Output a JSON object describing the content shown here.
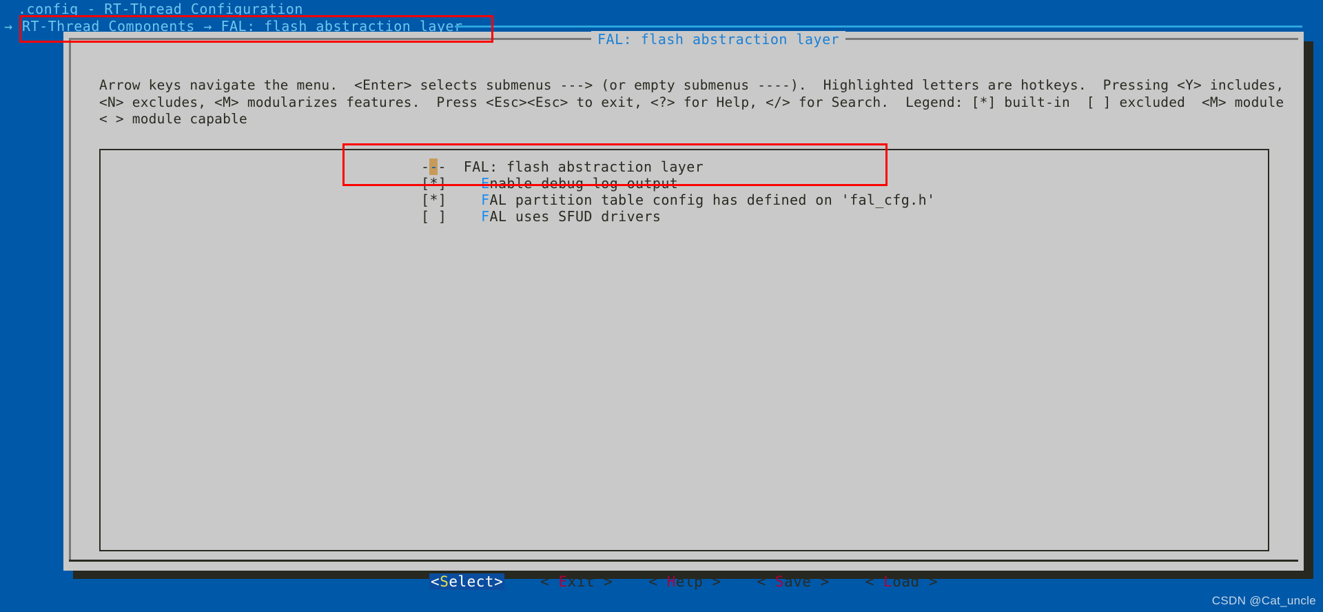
{
  "window": {
    "title": ".config - RT-Thread Configuration",
    "breadcrumb_arrow": "→",
    "breadcrumb": "RT-Thread Components → FAL: flash abstraction layer",
    "dialog_header": "FAL: flash abstraction layer"
  },
  "help": {
    "text": "Arrow keys navigate the menu.  <Enter> selects submenus ---> (or empty submenus ----).  Highlighted letters are hotkeys.  Pressing <Y> includes, <N> excludes, <M> modularizes features.  Press <Esc><Esc> to exit, <?> for Help, </> for Search.  Legend: [*] built-in  [ ] excluded  <M> module  < > module capable"
  },
  "menu": {
    "rows": [
      {
        "type": "header",
        "selected": true,
        "prefix": "-",
        "cursor": "-",
        "suffix": "-  ",
        "label": "FAL: flash abstraction layer"
      },
      {
        "type": "option",
        "selected": false,
        "state": "[*]",
        "hotkey": "E",
        "label": "nable debug log output"
      },
      {
        "type": "option",
        "selected": false,
        "state": "[*]",
        "hotkey": "F",
        "label": "AL partition table config has defined on 'fal_cfg.h'"
      },
      {
        "type": "option",
        "selected": false,
        "state": "[ ]",
        "hotkey": "F",
        "label": "AL uses SFUD drivers"
      }
    ]
  },
  "buttons": [
    {
      "name": "select",
      "open": "<",
      "hotkey": "S",
      "rest": "elect",
      "close": ">",
      "primary": true
    },
    {
      "name": "exit",
      "open": "< ",
      "hotkey": "E",
      "rest": "xit",
      "close": " >",
      "primary": false
    },
    {
      "name": "help",
      "open": "< ",
      "hotkey": "H",
      "rest": "elp",
      "close": " >",
      "primary": false
    },
    {
      "name": "save",
      "open": "< ",
      "hotkey": "S",
      "rest": "ave",
      "close": " >",
      "primary": false
    },
    {
      "name": "load",
      "open": "< ",
      "hotkey": "L",
      "rest": "oad",
      "close": " >",
      "primary": false
    }
  ],
  "watermark": "CSDN @Cat_uncle",
  "colors": {
    "desktop_blue": "#0058a8",
    "dialog_gray": "#c9c9c9",
    "accent_cyan": "#6ec6ef",
    "header_blue": "#1a7fd4",
    "hotkey_blue": "#1a8cf0",
    "selection_blue": "#0a5cab",
    "cursor_tan": "#c89a5a",
    "annotation_red": "#ff0000",
    "button_hotkey_red": "#b1003c"
  }
}
